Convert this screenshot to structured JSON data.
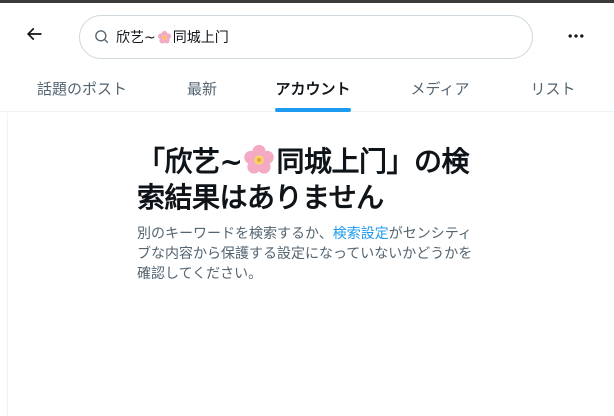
{
  "header": {
    "back_icon": "arrow-left-icon",
    "search_icon": "search-icon",
    "search_query_before": "欣艺~",
    "search_query_emoji": "cherry-blossom",
    "search_query_after": "同城上门",
    "more_icon": "more-horizontal-icon"
  },
  "tabs": [
    {
      "label": "話題のポスト",
      "active": false
    },
    {
      "label": "最新",
      "active": false
    },
    {
      "label": "アカウント",
      "active": true
    },
    {
      "label": "メディア",
      "active": false
    },
    {
      "label": "リスト",
      "active": false
    }
  ],
  "empty_state": {
    "title_before": "「欣艺~",
    "title_emoji": "cherry-blossom",
    "title_after": "同城上门」の検索結果はありません",
    "desc_before": "別のキーワードを検索するか、",
    "desc_link": "検索設定",
    "desc_after": "がセンシティブな内容から保護する設定になっていないかどうかを確認してください。"
  },
  "colors": {
    "accent": "#1d9bf0",
    "text_primary": "#0f1419",
    "text_secondary": "#536471",
    "border": "#cfd9de"
  }
}
